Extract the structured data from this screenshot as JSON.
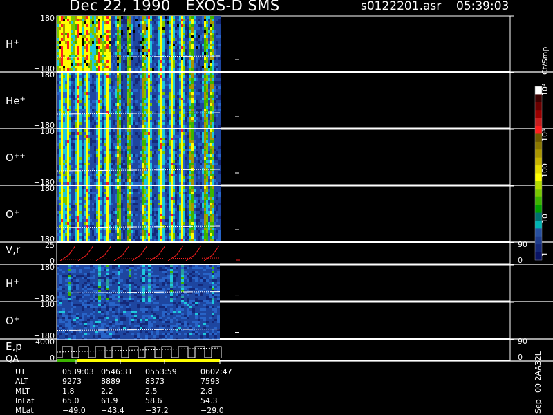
{
  "header": {
    "title": "Dec 22, 1990   EXOS-D SMS",
    "file": "s0122201.asr",
    "time": "05:39:03"
  },
  "panels": [
    {
      "label": "H",
      "sup": "+",
      "ymax": "180",
      "ymin": "−180"
    },
    {
      "label": "He",
      "sup": "+",
      "ymax": "180",
      "ymin": "−180"
    },
    {
      "label": "O",
      "sup": "++",
      "ymax": "180",
      "ymin": "−180"
    },
    {
      "label": "O",
      "sup": "+",
      "ymax": "180",
      "ymin": "−180"
    },
    {
      "label": "V,r",
      "sup": "",
      "ymax": "25",
      "ymin": "0",
      "right_top": "90",
      "right_bottom": "0"
    },
    {
      "label": "H",
      "sup": "+",
      "ymax": "180",
      "ymin": "−180"
    },
    {
      "label": "O",
      "sup": "+",
      "ymax": "180",
      "ymin": "−180"
    },
    {
      "label": "E,p",
      "label2": "QA",
      "sup": "",
      "ymax": "4000",
      "ymin": "0",
      "right_top": "90",
      "right_bottom": "0"
    }
  ],
  "colorbar": {
    "unit": "Ct/Smp",
    "ticks": [
      "10⁴",
      "10³",
      "100",
      "10",
      "1"
    ],
    "colors": [
      "#ffffff",
      "#3a0000",
      "#6a0000",
      "#9a0000",
      "#c81e1e",
      "#ff1e1e",
      "#6e5a00",
      "#8c7800",
      "#aa9600",
      "#c8b400",
      "#e6dc00",
      "#ffff00",
      "#b4dc00",
      "#78c800",
      "#3cb400",
      "#00a000",
      "#007070",
      "#00b4b4",
      "#2850a0",
      "#1e3c8c",
      "#142878",
      "#0a1464"
    ]
  },
  "times": {
    "rows": [
      {
        "label": "UT",
        "values": [
          "0539:03",
          "0546:31",
          "0553:59",
          "0602:47"
        ]
      },
      {
        "label": "ALT",
        "values": [
          "9273",
          "8889",
          "8373",
          "7593"
        ]
      },
      {
        "label": "MLT",
        "values": [
          "1.8",
          "2.2",
          "2.5",
          "2.8"
        ]
      },
      {
        "label": "InLat",
        "values": [
          "65.0",
          "61.9",
          "58.6",
          "54.3"
        ]
      },
      {
        "label": "MLat",
        "values": [
          "−49.0",
          "−43.4",
          "−37.2",
          "−29.0"
        ]
      }
    ]
  },
  "side_note": "Sep−00  2AA32L",
  "chart_data": {
    "type": "heatmap",
    "title": "Dec 22, 1990   EXOS-D SMS",
    "x_ticks": [
      "0539:03",
      "0546:31",
      "0553:59",
      "0602:47"
    ],
    "series": [
      {
        "name": "H+",
        "ylim": [
          -180,
          180
        ]
      },
      {
        "name": "He+",
        "ylim": [
          -180,
          180
        ]
      },
      {
        "name": "O++",
        "ylim": [
          -180,
          180
        ]
      },
      {
        "name": "O+",
        "ylim": [
          -180,
          180
        ]
      },
      {
        "name": "V,r",
        "ylim": [
          0,
          25
        ]
      },
      {
        "name": "H+",
        "ylim": [
          -180,
          180
        ]
      },
      {
        "name": "O+",
        "ylim": [
          -180,
          180
        ]
      },
      {
        "name": "E,p",
        "ylim": [
          0,
          4000
        ]
      }
    ],
    "colorbar_ticks": [
      "10⁴",
      "10³",
      "100",
      "10",
      "1"
    ]
  }
}
